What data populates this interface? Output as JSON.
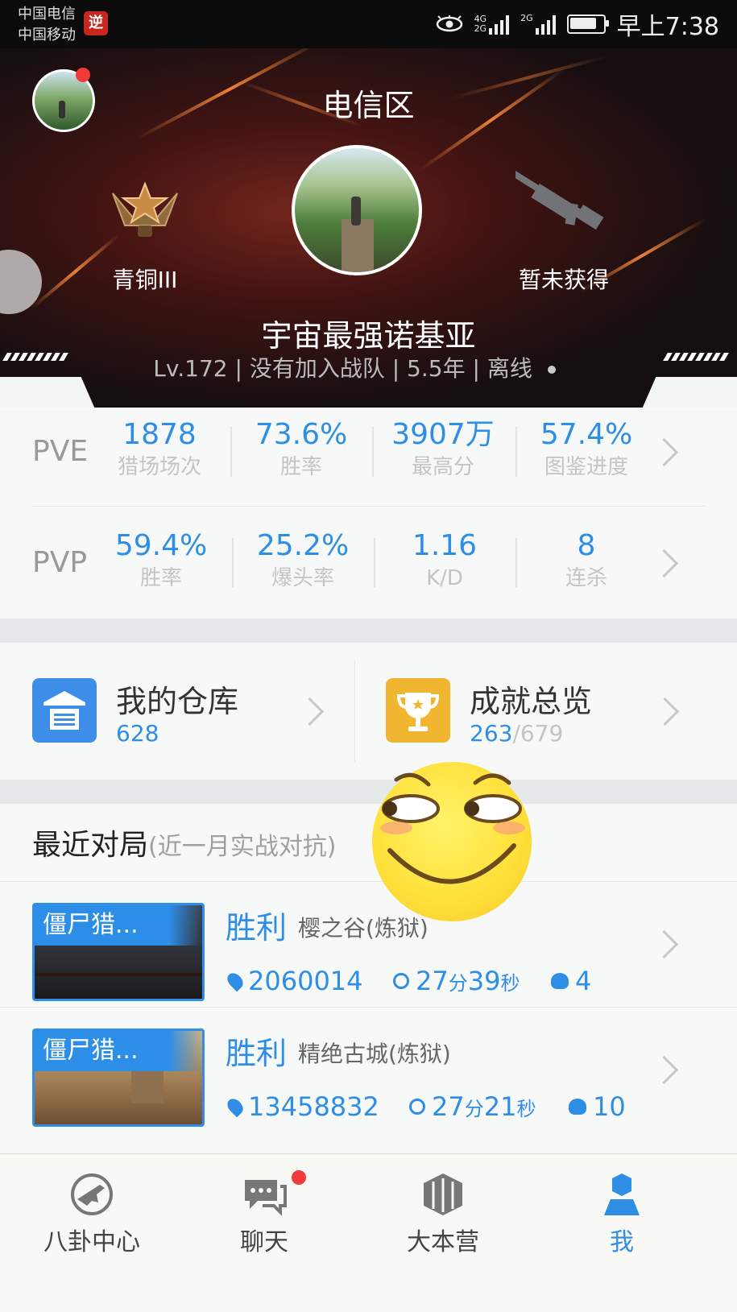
{
  "status_bar": {
    "carrier_1": "中国电信",
    "carrier_2": "中国移动",
    "app_badge": "逆",
    "net_top": "4G",
    "net_bottom": "2G",
    "net_2": "2G",
    "time": "早上7:38"
  },
  "header": {
    "region": "电信区",
    "rank_label": "青铜III",
    "weapon_label": "暂未获得",
    "player_name": "宇宙最强诺基亚",
    "player_info": "Lv.172 | 没有加入战队 | 5.5年 |  离线",
    "status_dot_color": "#c9c9c9"
  },
  "stats": {
    "pve": {
      "label": "PVE",
      "items": [
        {
          "value": "1878",
          "label": "猎场场次"
        },
        {
          "value": "73.6%",
          "label": "胜率"
        },
        {
          "value": "3907万",
          "label": "最高分"
        },
        {
          "value": "57.4%",
          "label": "图鉴进度"
        }
      ]
    },
    "pvp": {
      "label": "PVP",
      "items": [
        {
          "value": "59.4%",
          "label": "胜率"
        },
        {
          "value": "25.2%",
          "label": "爆头率"
        },
        {
          "value": "1.16",
          "label": "K/D"
        },
        {
          "value": "8",
          "label": "连杀"
        }
      ]
    }
  },
  "cards": {
    "warehouse": {
      "title": "我的仓库",
      "count": "628",
      "icon": "warehouse-icon",
      "color": "#3d8ee8"
    },
    "achievements": {
      "title": "成就总览",
      "done": "263",
      "total": "/679",
      "icon": "trophy-icon",
      "color": "#f1b62f"
    }
  },
  "recent": {
    "title": "最近对局",
    "subtitle": "(近一月实战对抗)",
    "matches": [
      {
        "mode": "僵尸猎...",
        "result": "胜利",
        "map": "樱之谷(炼狱)",
        "score": "2060014",
        "min": "27",
        "min_unit": "分",
        "sec": "39",
        "sec_unit": "秒",
        "kills": "4"
      },
      {
        "mode": "僵尸猎...",
        "result": "胜利",
        "map": "精绝古城(炼狱)",
        "score": "13458832",
        "min": "27",
        "min_unit": "分",
        "sec": "21",
        "sec_unit": "秒",
        "kills": "10"
      }
    ]
  },
  "tabbar": {
    "tabs": [
      {
        "label": "八卦中心",
        "icon": "gossip-gun-icon"
      },
      {
        "label": "聊天",
        "icon": "chat-icon"
      },
      {
        "label": "大本营",
        "icon": "base-hexagon-icon"
      },
      {
        "label": "我",
        "icon": "me-person-icon"
      }
    ],
    "accent_color": "#2e8ee6"
  }
}
